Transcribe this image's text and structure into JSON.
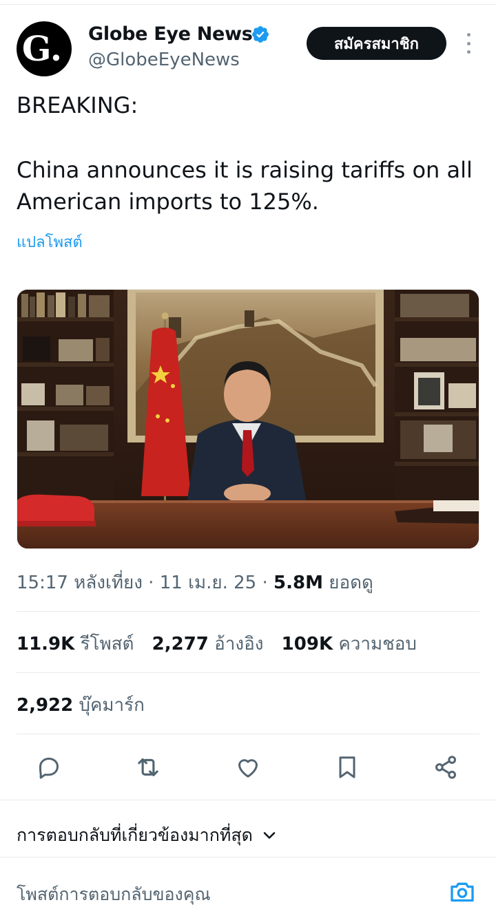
{
  "author": {
    "avatar_letter": "G.",
    "name": "Globe Eye News",
    "handle": "@GlobeEyeNews",
    "verified_icon": "verified-badge-icon",
    "subscribe_label": "สมัครสมาชิก"
  },
  "post": {
    "line1": "BREAKING:",
    "line2": "China announces it is raising tariffs on all American imports to 125%.",
    "translate_label": "แปลโพสต์"
  },
  "meta": {
    "time": "15:17 หลังเที่ยง",
    "date": "11 เม.ย. 25",
    "views_count": "5.8M",
    "views_label": "ยอดดู"
  },
  "stats": {
    "reposts_count": "11.9K",
    "reposts_label": "รีโพสต์",
    "quotes_count": "2,277",
    "quotes_label": "อ้างอิง",
    "likes_count": "109K",
    "likes_label": "ความชอบ",
    "bookmarks_count": "2,922",
    "bookmarks_label": "บุ๊คมาร์ก"
  },
  "actions": [
    "reply-icon",
    "repost-icon",
    "like-icon",
    "bookmark-icon",
    "share-icon"
  ],
  "replies": {
    "sort_label": "การตอบกลับที่เกี่ยวข้องมากที่สุด",
    "compose_placeholder": "โพสต์การตอบกลับของคุณ"
  },
  "colors": {
    "accent": "#1d9bf0",
    "text": "#0f1419",
    "secondary": "#536471",
    "divider": "#e6e9ea"
  }
}
